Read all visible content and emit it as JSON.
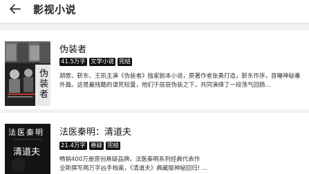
{
  "header": {
    "back_icon": "arrow-left-icon",
    "title": "影视小说"
  },
  "books": [
    {
      "title": "伪装者",
      "tags": [
        "41.5万字",
        "文学小说",
        "完结"
      ],
      "description": "胡歌、靳东、王凯主演《伪装者》独家剧本小说，原著作者张勇打造，靳东作序，首曝神秘番外篇。这是最残酷的谍死较量，他们于层层伪装之下，共同演绎了一段荡气回肠...",
      "cover_text": "伪装者"
    },
    {
      "title": "法医秦明：清道夫",
      "tags": [
        "21.4万字",
        "悬疑",
        "完结"
      ],
      "description": "畅销400万册原创悬疑品牌，法医秦明系列经典代表作\n    全新撰写两万字凶手档案，《清道夫》典藏版神秘回归! ...",
      "cover_text_top": "法医秦明",
      "cover_text_main": "清道夫"
    }
  ],
  "colors": {
    "tag_bg": "#111111",
    "tag_fg": "#ffffff",
    "background": "#f1f1f1"
  }
}
